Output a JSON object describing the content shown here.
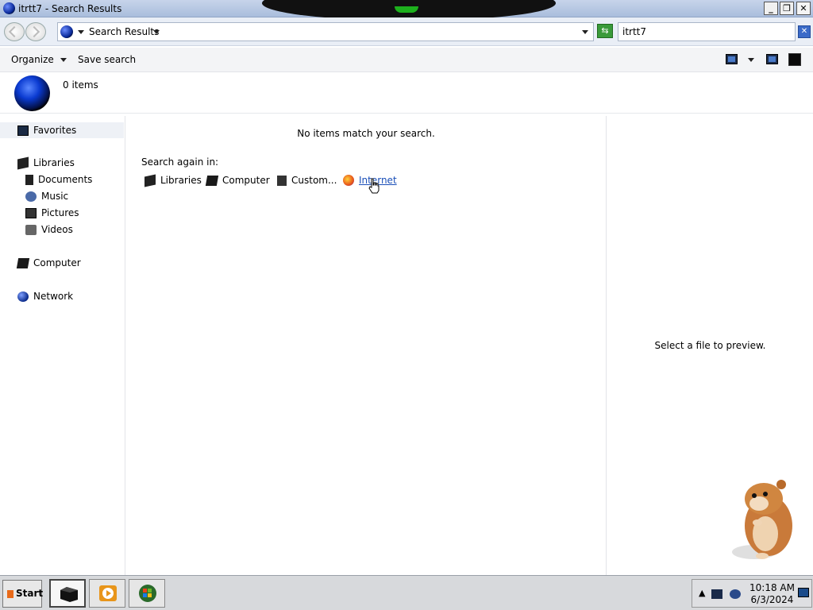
{
  "window": {
    "title": "itrtt7 - Search Results",
    "buttons": {
      "minimize": "_",
      "maximize": "❐",
      "close": "✕"
    }
  },
  "address": {
    "location": "Search Results",
    "search_value": "itrtt7"
  },
  "toolbar": {
    "organize_label": "Organize",
    "save_search_label": "Save search"
  },
  "info": {
    "items_count": "0 items"
  },
  "nav": {
    "favorites": "Favorites",
    "libraries": "Libraries",
    "documents": "Documents",
    "music": "Music",
    "pictures": "Pictures",
    "videos": "Videos",
    "computer": "Computer",
    "network": "Network"
  },
  "content": {
    "no_items_message": "No items match your search.",
    "search_again_label": "Search again in:",
    "search_again_options": {
      "libraries": "Libraries",
      "computer": "Computer",
      "custom": "Custom...",
      "internet": "Internet"
    }
  },
  "preview": {
    "message": "Select a file to preview."
  },
  "taskbar": {
    "start_label": "Start",
    "time": "10:18 AM",
    "date": "6/3/2024"
  },
  "colors": {
    "link": "#1a4fb8",
    "titlebar": "#b8c8e4"
  }
}
